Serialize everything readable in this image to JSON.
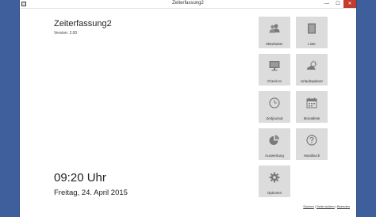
{
  "window": {
    "title": "Zeiterfassung2",
    "minimize": "—",
    "maximize": "☐",
    "close": "✕"
  },
  "app": {
    "title": "Zeiterfassung2",
    "version": "Version: 2.00"
  },
  "clock": {
    "time": "09:20 Uhr",
    "date": "Freitag, 24. April 2015"
  },
  "tiles": [
    {
      "label": "Mitarbeiter",
      "icon": "users-icon"
    },
    {
      "label": "Liste",
      "icon": "list-icon"
    },
    {
      "label": "Check-In",
      "icon": "monitor-icon"
    },
    {
      "label": "Urlaubsplaner",
      "icon": "weather-icon"
    },
    {
      "label": "Zeitjournal",
      "icon": "clock-icon"
    },
    {
      "label": "Monatliste",
      "icon": "calendar-icon"
    },
    {
      "label": "Auswertung",
      "icon": "pie-chart-icon"
    },
    {
      "label": "Handbuch",
      "icon": "help-icon"
    },
    {
      "label": "Optionen",
      "icon": "gear-icon"
    }
  ],
  "footer": {
    "search": "Suchen",
    "lock": "Seite sichten",
    "quit": "Beenden"
  },
  "colors": {
    "desktop": "#3f5f9c",
    "tile": "#dcdcdc",
    "icon": "#7a7a7a",
    "close_button": "#c43b2f"
  }
}
